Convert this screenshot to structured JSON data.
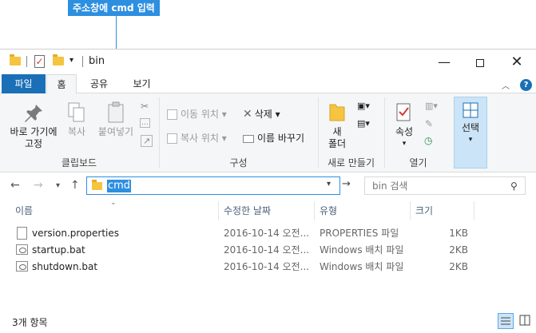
{
  "annotation": {
    "text": "주소창에 cmd 입력"
  },
  "window": {
    "title": "bin"
  },
  "ribbon_tabs": {
    "file": "파일",
    "home": "홈",
    "share": "공유",
    "view": "보기"
  },
  "clipboard": {
    "pin_line1": "바로 가기에",
    "pin_line2": "고정",
    "copy": "복사",
    "paste": "붙여넣기",
    "label": "클립보드"
  },
  "organize": {
    "move_to": "이동 위치",
    "copy_to": "복사 위치",
    "delete": "삭제",
    "rename": "이름 바꾸기",
    "label": "구성"
  },
  "new_group": {
    "new_folder_line1": "새",
    "new_folder_line2": "폴더",
    "label": "새로 만들기"
  },
  "open_group": {
    "properties": "속성",
    "label": "열기"
  },
  "select_group": {
    "select": "선택"
  },
  "address": {
    "value": "cmd"
  },
  "search": {
    "placeholder": "bin 검색"
  },
  "columns": {
    "name": "이름",
    "date": "수정한 날짜",
    "type": "유형",
    "size": "크기"
  },
  "files": [
    {
      "name": "version.properties",
      "date": "2016-10-14 오전...",
      "type": "PROPERTIES 파일",
      "size": "1KB",
      "icon": "document-icon"
    },
    {
      "name": "startup.bat",
      "date": "2016-10-14 오전...",
      "type": "Windows 배치 파일",
      "size": "2KB",
      "icon": "batch-file-icon"
    },
    {
      "name": "shutdown.bat",
      "date": "2016-10-14 오전...",
      "type": "Windows 배치 파일",
      "size": "2KB",
      "icon": "batch-file-icon"
    }
  ],
  "status": {
    "count": "3개 항목"
  },
  "colors": {
    "accent": "#2d8fe0",
    "file_tab": "#1a6fb7",
    "selection": "#cce4f7",
    "folder": "#f5c440"
  }
}
